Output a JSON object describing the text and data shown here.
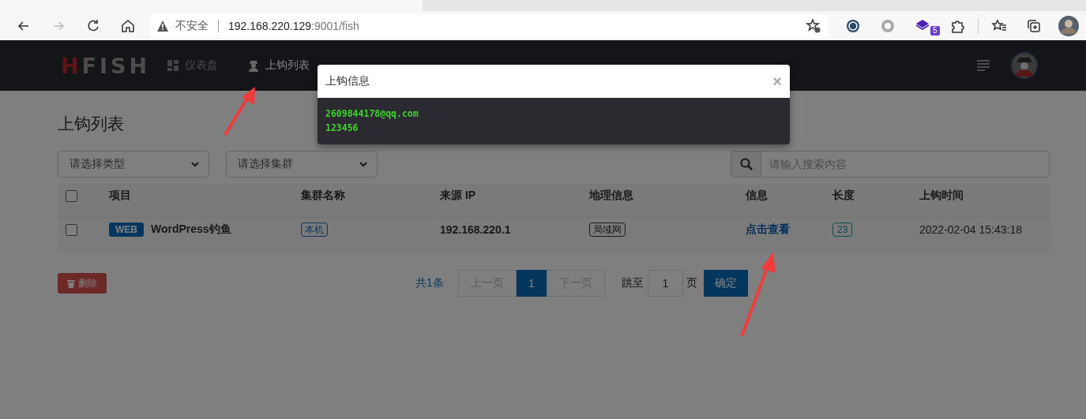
{
  "browser": {
    "security_label": "不安全",
    "url_host": "192.168.220.129",
    "url_rest": ":9001/fish",
    "extension_badge": "5"
  },
  "navbar": {
    "logo": "HFISH",
    "items": [
      {
        "label": "仪表盘",
        "selected": false
      },
      {
        "label": "上钩列表",
        "selected": true
      }
    ]
  },
  "page": {
    "title": "上钩列表",
    "type_select": "请选择类型",
    "cluster_select": "请选择集群",
    "search_placeholder": "请输入搜索内容"
  },
  "table": {
    "header_checked": false,
    "columns": [
      "项目",
      "集群名称",
      "来源 IP",
      "地理信息",
      "信息",
      "长度",
      "上钩时间"
    ],
    "rows": [
      {
        "checked": false,
        "type_tag": "WEB",
        "project": "WordPress钓鱼",
        "cluster": "本机",
        "ip": "192.168.220.1",
        "geo": "局域网",
        "info": "点击查看",
        "length": "23",
        "time": "2022-02-04 15:43:18"
      }
    ]
  },
  "footer": {
    "delete": "删除",
    "total": "共1条",
    "prev": {
      "label": "上一页",
      "disabled": true
    },
    "pages": [
      {
        "label": "1",
        "selected": true
      }
    ],
    "next": {
      "label": "下一页",
      "disabled": true
    },
    "jump_label": "跳至",
    "jump_value": "1",
    "page_unit": "页",
    "confirm": "确定"
  },
  "modal": {
    "title": "上钩信息",
    "close": "×",
    "lines": [
      "2609844178@qq.com",
      "123456"
    ]
  }
}
